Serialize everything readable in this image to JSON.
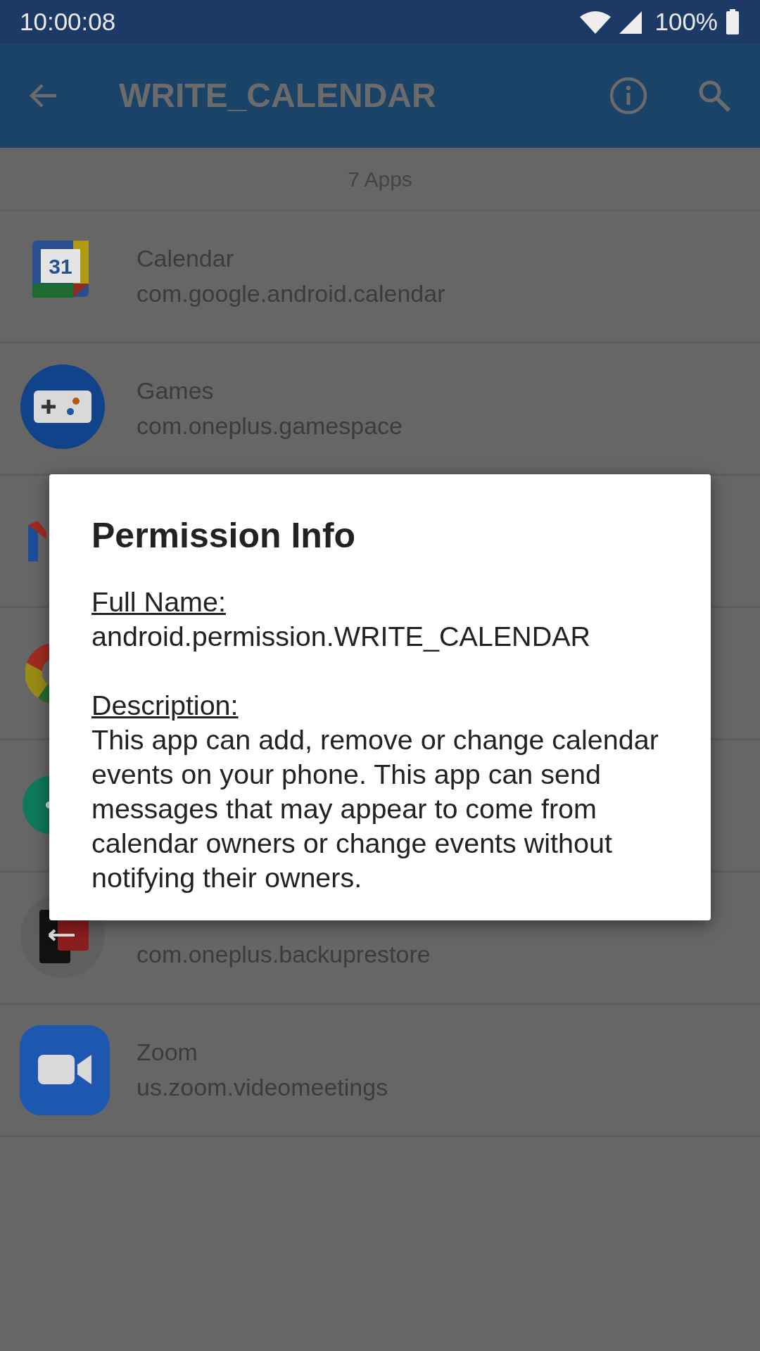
{
  "status_bar": {
    "time": "10:00:08",
    "battery": "100%"
  },
  "app_bar": {
    "title": "WRITE_CALENDAR"
  },
  "list_header": "7 Apps",
  "apps": [
    {
      "kind": "app",
      "name": "Calendar",
      "package": "com.google.android.calendar",
      "icon_text": "31"
    },
    {
      "kind": "app",
      "name": "Games",
      "package": "com.oneplus.gamespace"
    },
    {
      "kind": "covered"
    },
    {
      "kind": "covered"
    },
    {
      "kind": "covered"
    },
    {
      "kind": "app",
      "package": "com.oneplus.backuprestore"
    },
    {
      "kind": "app",
      "name": "Zoom",
      "package": "us.zoom.videomeetings"
    }
  ],
  "dialog": {
    "title": "Permission Info",
    "full_name_label": "Full Name:",
    "full_name": "android.permission.WRITE_CALENDAR",
    "description_label": "Description:",
    "description": "This app can add, remove or change calendar events on your phone. This app can send messages that may appear to come from calendar owners or change events without notifying their owners."
  }
}
